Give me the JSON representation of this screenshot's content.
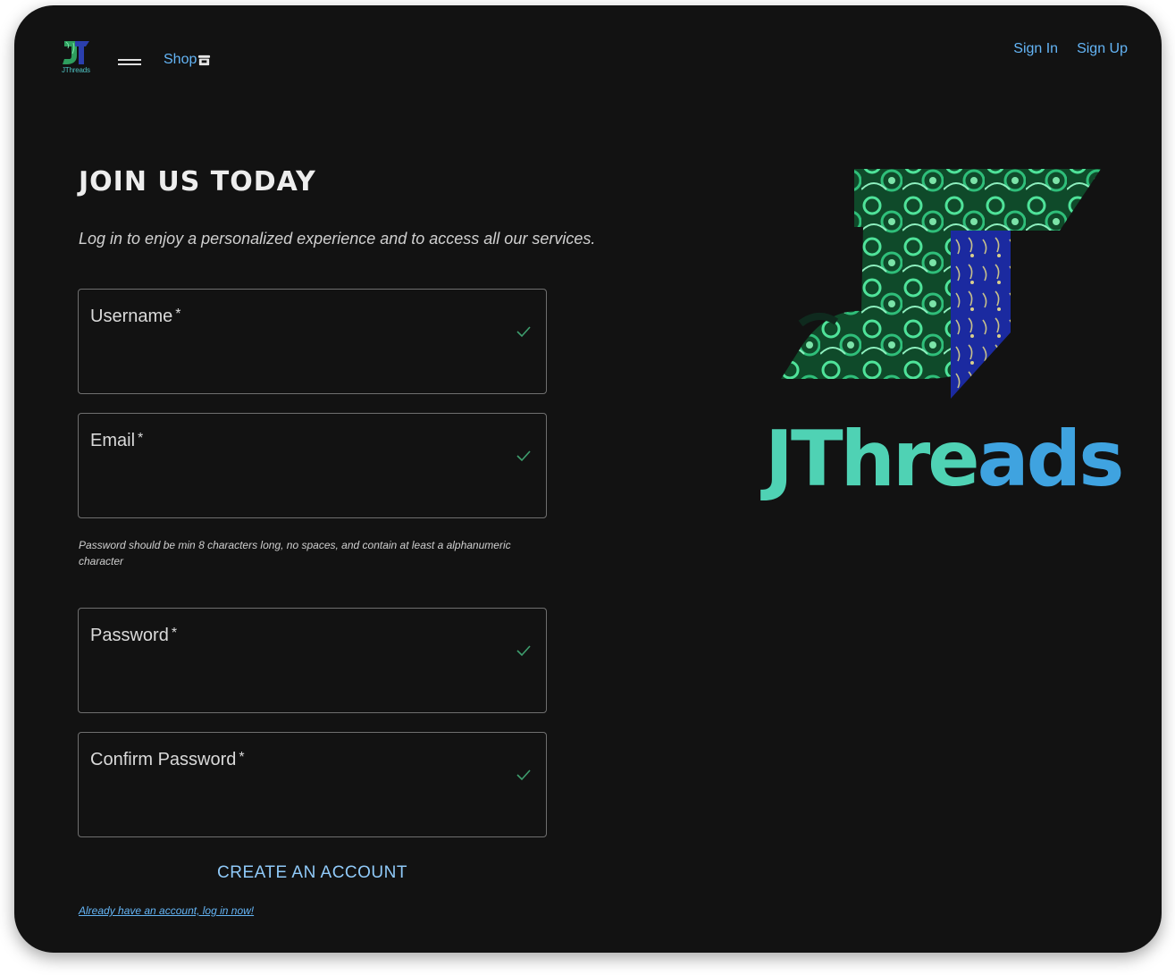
{
  "nav": {
    "logo_text": "JThreads",
    "shop_label": "Shop",
    "sign_in": "Sign In",
    "sign_up": "Sign Up"
  },
  "form": {
    "title": "JOIN US TODAY",
    "subtitle": "Log in to enjoy a personalized experience and to access all our services.",
    "fields": [
      {
        "label": "Username",
        "required": "*"
      },
      {
        "label": "Email",
        "required": "*"
      },
      {
        "label": "Password",
        "required": "*"
      },
      {
        "label": "Confirm Password",
        "required": "*"
      }
    ],
    "password_hint": "Password should be min 8 characters long, no spaces, and contain at least a alphanumeric character",
    "create_button": "CREATE AN ACCOUNT",
    "login_link": "Already have an account, log in now!"
  },
  "hero": {
    "brand_part1": "JThre",
    "brand_part2": "ads"
  },
  "colors": {
    "background": "#121212",
    "link": "#64b5f6",
    "check": "#3e9e6e",
    "brand_green": "#4fd2b4",
    "brand_blue": "#3fa3e0"
  },
  "icons": [
    "menu-icon",
    "storefront-icon",
    "check-icon"
  ]
}
